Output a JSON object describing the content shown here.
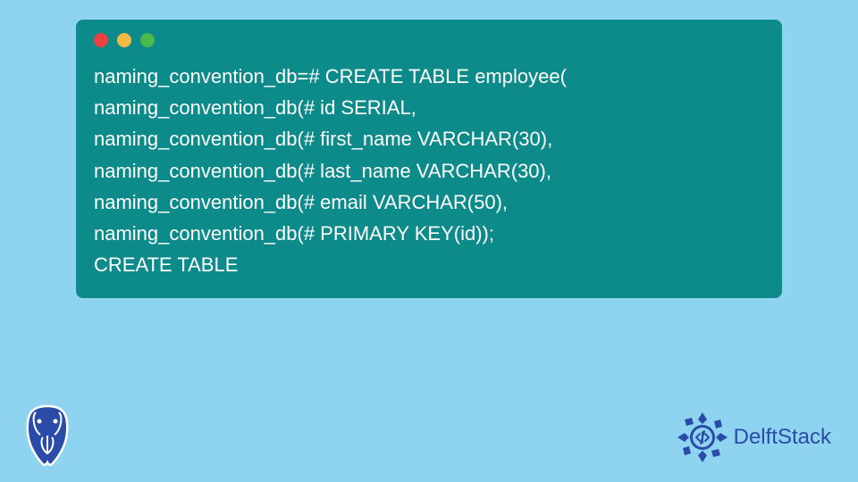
{
  "terminal": {
    "lines": [
      "naming_convention_db=# CREATE TABLE employee(",
      "naming_convention_db(# id SERIAL,",
      "naming_convention_db(# first_name VARCHAR(30),",
      "naming_convention_db(# last_name VARCHAR(30),",
      "naming_convention_db(# email VARCHAR(50),",
      "naming_convention_db(# PRIMARY KEY(id));",
      "CREATE TABLE"
    ]
  },
  "branding": {
    "delft_text": "DelftStack"
  },
  "colors": {
    "background": "#8ed3ef",
    "terminal": "#0d8a8a",
    "delft_blue": "#2b4ba8"
  }
}
